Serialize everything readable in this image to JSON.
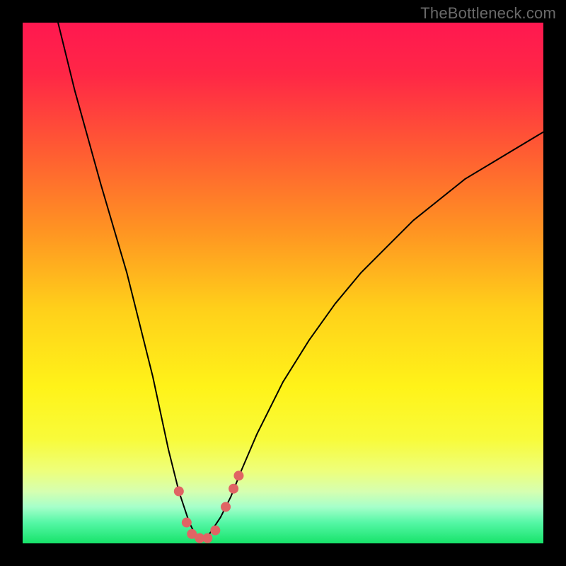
{
  "watermark": "TheBottleneck.com",
  "chart_data": {
    "type": "line",
    "title": "",
    "xlabel": "",
    "ylabel": "",
    "xlim": [
      0,
      100
    ],
    "ylim": [
      0,
      100
    ],
    "grid": false,
    "series": [
      {
        "name": "curve",
        "x": [
          6.8,
          10,
          15,
          20,
          25,
          28,
          30,
          32,
          33,
          34,
          35,
          36,
          38,
          40,
          42,
          45,
          50,
          55,
          60,
          65,
          70,
          75,
          80,
          85,
          90,
          95,
          100
        ],
        "y": [
          100,
          87,
          69,
          52,
          32,
          18,
          10,
          4,
          2,
          1,
          1,
          2,
          5,
          9,
          14,
          21,
          31,
          39,
          46,
          52,
          57,
          62,
          66,
          70,
          73,
          76,
          79
        ]
      }
    ],
    "markers": [
      {
        "x": 30.0,
        "y": 10.0
      },
      {
        "x": 31.5,
        "y": 4.0
      },
      {
        "x": 32.5,
        "y": 1.8
      },
      {
        "x": 34.0,
        "y": 1.0
      },
      {
        "x": 35.5,
        "y": 1.0
      },
      {
        "x": 37.0,
        "y": 2.5
      },
      {
        "x": 39.0,
        "y": 7.0
      },
      {
        "x": 40.5,
        "y": 10.5
      },
      {
        "x": 41.5,
        "y": 13.0
      }
    ],
    "gradient_stops": [
      {
        "pos": 0.0,
        "color": "#ff1850"
      },
      {
        "pos": 0.1,
        "color": "#ff2746"
      },
      {
        "pos": 0.25,
        "color": "#ff5d32"
      },
      {
        "pos": 0.4,
        "color": "#ff9422"
      },
      {
        "pos": 0.55,
        "color": "#ffd01a"
      },
      {
        "pos": 0.7,
        "color": "#fff319"
      },
      {
        "pos": 0.8,
        "color": "#f8fb3a"
      },
      {
        "pos": 0.86,
        "color": "#eeff7a"
      },
      {
        "pos": 0.9,
        "color": "#d6ffb0"
      },
      {
        "pos": 0.93,
        "color": "#a6ffca"
      },
      {
        "pos": 0.96,
        "color": "#55f7a6"
      },
      {
        "pos": 1.0,
        "color": "#17e36a"
      }
    ],
    "marker_color": "#e06464",
    "curve_color": "#000000"
  }
}
